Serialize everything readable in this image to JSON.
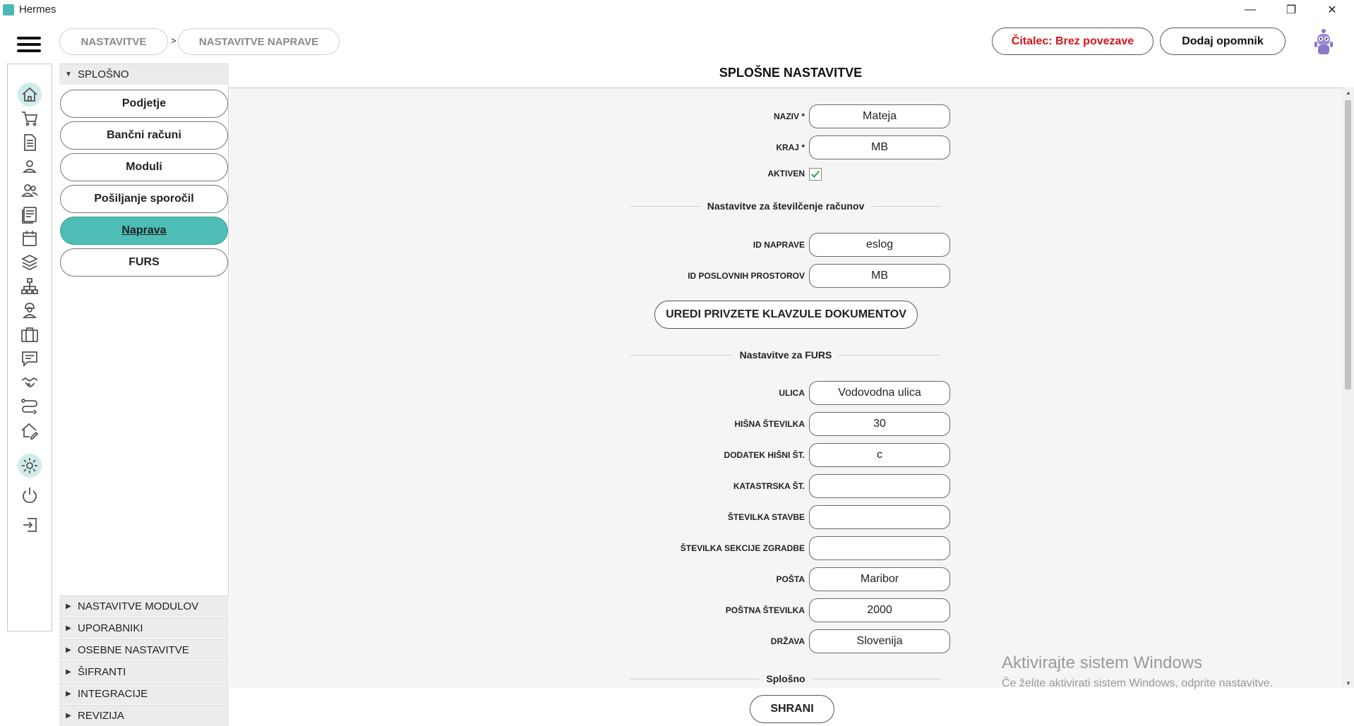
{
  "window": {
    "title": "Hermes",
    "controls": {
      "minimize": "—",
      "restore": "❐",
      "close": "✕"
    }
  },
  "breadcrumb": [
    {
      "label": "NASTAVITVE"
    },
    {
      "label": "NASTAVITVE NAPRAVE"
    }
  ],
  "breadcrumb_separator": ">",
  "header": {
    "reader_status": "Čitalec: Brez povezave",
    "reader_status_color": "#d8141b",
    "add_reminder": "Dodaj opomnik"
  },
  "rail": {
    "items": [
      {
        "name": "home-icon",
        "active": true
      },
      {
        "name": "cart-icon"
      },
      {
        "name": "document-icon"
      },
      {
        "name": "user-icon"
      },
      {
        "name": "users-icon"
      },
      {
        "name": "list-document-icon"
      },
      {
        "name": "calendar-icon"
      },
      {
        "name": "layers-icon"
      },
      {
        "name": "hierarchy-icon"
      },
      {
        "name": "worker-icon"
      },
      {
        "name": "briefcase-icon"
      },
      {
        "name": "chat-icon"
      },
      {
        "name": "handshake-icon"
      },
      {
        "name": "route-icon"
      },
      {
        "name": "home-edit-icon"
      },
      {
        "name": "gear-icon",
        "active": true
      },
      {
        "name": "power-icon"
      },
      {
        "name": "logout-icon"
      }
    ]
  },
  "side": {
    "general_header": "SPLOŠNO",
    "buttons": [
      {
        "label": "Podjetje"
      },
      {
        "label": "Bančni računi"
      },
      {
        "label": "Moduli"
      },
      {
        "label": "Pošiljanje sporočil"
      },
      {
        "label": "Naprava",
        "selected": true
      },
      {
        "label": "FURS"
      }
    ],
    "sections": [
      {
        "label": "NASTAVITVE MODULOV"
      },
      {
        "label": "UPORABNIKI"
      },
      {
        "label": "OSEBNE NASTAVITVE"
      },
      {
        "label": "ŠIFRANTI"
      },
      {
        "label": "INTEGRACIJE"
      },
      {
        "label": "REVIZIJA"
      }
    ]
  },
  "main": {
    "title": "SPLOŠNE NASTAVITVE",
    "fields_top": [
      {
        "label": "NAZIV *",
        "value": "Mateja"
      },
      {
        "label": "KRAJ *",
        "value": "MB"
      }
    ],
    "active_label": "AKTIVEN",
    "active_checked": true,
    "numbering_section": "Nastavitve za številčenje računov",
    "numbering_fields": [
      {
        "label": "ID NAPRAVE",
        "value": "eslog"
      },
      {
        "label": "ID POSLOVNIH PROSTOROV",
        "value": "MB"
      }
    ],
    "edit_clauses_button": "UREDI PRIVZETE KLAVZULE DOKUMENTOV",
    "furs_section": "Nastavitve za FURS",
    "furs_fields": [
      {
        "label": "ULICA",
        "value": "Vodovodna ulica"
      },
      {
        "label": "HIŠNA ŠTEVILKA",
        "value": "30"
      },
      {
        "label": "DODATEK HIŠNI ŠT.",
        "value": "c"
      },
      {
        "label": "KATASTRSKA ŠT.",
        "value": ""
      },
      {
        "label": "ŠTEVILKA STAVBE",
        "value": ""
      },
      {
        "label": "ŠTEVILKA SEKCIJE ZGRADBE",
        "value": ""
      },
      {
        "label": "POŠTA",
        "value": "Maribor"
      },
      {
        "label": "POŠTNA ŠTEVILKA",
        "value": "2000"
      },
      {
        "label": "DRŽAVA",
        "value": "Slovenija"
      }
    ],
    "general_section": "Splošno",
    "save_button": "SHRANI"
  },
  "watermark": {
    "title": "Aktivirajte sistem Windows",
    "subtitle": "Če želite aktivirati sistem Windows, odprite nastavitve."
  },
  "colors": {
    "accent": "#4dbdb5",
    "checkbox": "#1a8f3c"
  }
}
